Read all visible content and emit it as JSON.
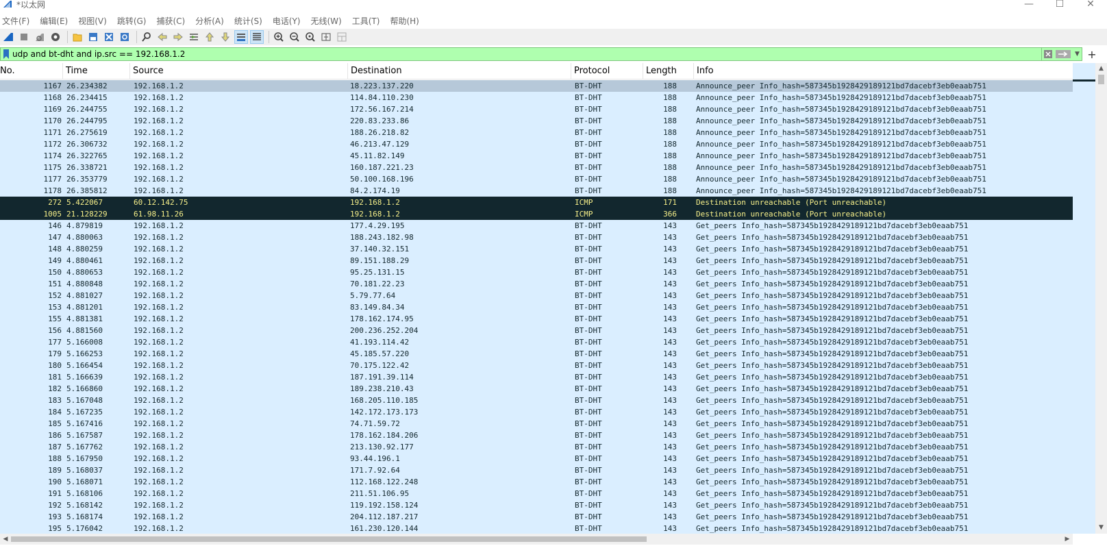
{
  "window": {
    "title": "*以太网"
  },
  "menu": [
    "文件(F)",
    "编辑(E)",
    "视图(V)",
    "跳转(G)",
    "捕获(C)",
    "分析(A)",
    "统计(S)",
    "电话(Y)",
    "无线(W)",
    "工具(T)",
    "帮助(H)"
  ],
  "filter": {
    "value": "udp and bt-dht and ip.src == 192.168.1.2"
  },
  "columns": {
    "no": "No.",
    "time": "Time",
    "source": "Source",
    "destination": "Destination",
    "protocol": "Protocol",
    "length": "Length",
    "info": "Info"
  },
  "colors": {
    "row_bg": "#daeeff",
    "selected_bg": "#b6c8d9",
    "icmp_bg": "#12272e",
    "icmp_fg": "#f7f08a",
    "filter_bg": "#afffaf"
  },
  "packets": [
    {
      "no": "1167",
      "time": "26.234382",
      "src": "192.168.1.2",
      "dst": "18.223.137.220",
      "proto": "BT-DHT",
      "len": "188",
      "info": "Announce_peer Info_hash=587345b1928429189121bd7dacebf3eb0eaab751",
      "style": "selected"
    },
    {
      "no": "1168",
      "time": "26.234415",
      "src": "192.168.1.2",
      "dst": "114.84.110.230",
      "proto": "BT-DHT",
      "len": "188",
      "info": "Announce_peer Info_hash=587345b1928429189121bd7dacebf3eb0eaab751",
      "style": "normal"
    },
    {
      "no": "1169",
      "time": "26.244755",
      "src": "192.168.1.2",
      "dst": "172.56.167.214",
      "proto": "BT-DHT",
      "len": "188",
      "info": "Announce_peer Info_hash=587345b1928429189121bd7dacebf3eb0eaab751",
      "style": "normal"
    },
    {
      "no": "1170",
      "time": "26.244795",
      "src": "192.168.1.2",
      "dst": "220.83.233.86",
      "proto": "BT-DHT",
      "len": "188",
      "info": "Announce_peer Info_hash=587345b1928429189121bd7dacebf3eb0eaab751",
      "style": "normal"
    },
    {
      "no": "1171",
      "time": "26.275619",
      "src": "192.168.1.2",
      "dst": "188.26.218.82",
      "proto": "BT-DHT",
      "len": "188",
      "info": "Announce_peer Info_hash=587345b1928429189121bd7dacebf3eb0eaab751",
      "style": "normal"
    },
    {
      "no": "1172",
      "time": "26.306732",
      "src": "192.168.1.2",
      "dst": "46.213.47.129",
      "proto": "BT-DHT",
      "len": "188",
      "info": "Announce_peer Info_hash=587345b1928429189121bd7dacebf3eb0eaab751",
      "style": "normal"
    },
    {
      "no": "1174",
      "time": "26.322765",
      "src": "192.168.1.2",
      "dst": "45.11.82.149",
      "proto": "BT-DHT",
      "len": "188",
      "info": "Announce_peer Info_hash=587345b1928429189121bd7dacebf3eb0eaab751",
      "style": "normal"
    },
    {
      "no": "1175",
      "time": "26.338721",
      "src": "192.168.1.2",
      "dst": "160.187.221.23",
      "proto": "BT-DHT",
      "len": "188",
      "info": "Announce_peer Info_hash=587345b1928429189121bd7dacebf3eb0eaab751",
      "style": "normal"
    },
    {
      "no": "1177",
      "time": "26.353779",
      "src": "192.168.1.2",
      "dst": "50.100.168.196",
      "proto": "BT-DHT",
      "len": "188",
      "info": "Announce_peer Info_hash=587345b1928429189121bd7dacebf3eb0eaab751",
      "style": "normal"
    },
    {
      "no": "1178",
      "time": "26.385812",
      "src": "192.168.1.2",
      "dst": "84.2.174.19",
      "proto": "BT-DHT",
      "len": "188",
      "info": "Announce_peer Info_hash=587345b1928429189121bd7dacebf3eb0eaab751",
      "style": "normal"
    },
    {
      "no": "272",
      "time": "5.422067",
      "src": "60.12.142.75",
      "dst": "192.168.1.2",
      "proto": "ICMP",
      "len": "171",
      "info": "Destination unreachable (Port unreachable)",
      "style": "dark"
    },
    {
      "no": "1005",
      "time": "21.128229",
      "src": "61.98.11.26",
      "dst": "192.168.1.2",
      "proto": "ICMP",
      "len": "366",
      "info": "Destination unreachable (Port unreachable)",
      "style": "dark"
    },
    {
      "no": "146",
      "time": "4.879819",
      "src": "192.168.1.2",
      "dst": "177.4.29.195",
      "proto": "BT-DHT",
      "len": "143",
      "info": "Get_peers Info_hash=587345b1928429189121bd7dacebf3eb0eaab751",
      "style": "normal"
    },
    {
      "no": "147",
      "time": "4.880063",
      "src": "192.168.1.2",
      "dst": "188.243.182.98",
      "proto": "BT-DHT",
      "len": "143",
      "info": "Get_peers Info_hash=587345b1928429189121bd7dacebf3eb0eaab751",
      "style": "normal"
    },
    {
      "no": "148",
      "time": "4.880259",
      "src": "192.168.1.2",
      "dst": "37.140.32.151",
      "proto": "BT-DHT",
      "len": "143",
      "info": "Get_peers Info_hash=587345b1928429189121bd7dacebf3eb0eaab751",
      "style": "normal"
    },
    {
      "no": "149",
      "time": "4.880461",
      "src": "192.168.1.2",
      "dst": "89.151.188.29",
      "proto": "BT-DHT",
      "len": "143",
      "info": "Get_peers Info_hash=587345b1928429189121bd7dacebf3eb0eaab751",
      "style": "normal"
    },
    {
      "no": "150",
      "time": "4.880653",
      "src": "192.168.1.2",
      "dst": "95.25.131.15",
      "proto": "BT-DHT",
      "len": "143",
      "info": "Get_peers Info_hash=587345b1928429189121bd7dacebf3eb0eaab751",
      "style": "normal"
    },
    {
      "no": "151",
      "time": "4.880848",
      "src": "192.168.1.2",
      "dst": "70.181.22.23",
      "proto": "BT-DHT",
      "len": "143",
      "info": "Get_peers Info_hash=587345b1928429189121bd7dacebf3eb0eaab751",
      "style": "normal"
    },
    {
      "no": "152",
      "time": "4.881027",
      "src": "192.168.1.2",
      "dst": "5.79.77.64",
      "proto": "BT-DHT",
      "len": "143",
      "info": "Get_peers Info_hash=587345b1928429189121bd7dacebf3eb0eaab751",
      "style": "normal"
    },
    {
      "no": "153",
      "time": "4.881201",
      "src": "192.168.1.2",
      "dst": "83.149.84.34",
      "proto": "BT-DHT",
      "len": "143",
      "info": "Get_peers Info_hash=587345b1928429189121bd7dacebf3eb0eaab751",
      "style": "normal"
    },
    {
      "no": "155",
      "time": "4.881381",
      "src": "192.168.1.2",
      "dst": "178.162.174.95",
      "proto": "BT-DHT",
      "len": "143",
      "info": "Get_peers Info_hash=587345b1928429189121bd7dacebf3eb0eaab751",
      "style": "normal"
    },
    {
      "no": "156",
      "time": "4.881560",
      "src": "192.168.1.2",
      "dst": "200.236.252.204",
      "proto": "BT-DHT",
      "len": "143",
      "info": "Get_peers Info_hash=587345b1928429189121bd7dacebf3eb0eaab751",
      "style": "normal"
    },
    {
      "no": "177",
      "time": "5.166008",
      "src": "192.168.1.2",
      "dst": "41.193.114.42",
      "proto": "BT-DHT",
      "len": "143",
      "info": "Get_peers Info_hash=587345b1928429189121bd7dacebf3eb0eaab751",
      "style": "normal"
    },
    {
      "no": "179",
      "time": "5.166253",
      "src": "192.168.1.2",
      "dst": "45.185.57.220",
      "proto": "BT-DHT",
      "len": "143",
      "info": "Get_peers Info_hash=587345b1928429189121bd7dacebf3eb0eaab751",
      "style": "normal"
    },
    {
      "no": "180",
      "time": "5.166454",
      "src": "192.168.1.2",
      "dst": "70.175.122.42",
      "proto": "BT-DHT",
      "len": "143",
      "info": "Get_peers Info_hash=587345b1928429189121bd7dacebf3eb0eaab751",
      "style": "normal"
    },
    {
      "no": "181",
      "time": "5.166639",
      "src": "192.168.1.2",
      "dst": "187.191.39.114",
      "proto": "BT-DHT",
      "len": "143",
      "info": "Get_peers Info_hash=587345b1928429189121bd7dacebf3eb0eaab751",
      "style": "normal"
    },
    {
      "no": "182",
      "time": "5.166860",
      "src": "192.168.1.2",
      "dst": "189.238.210.43",
      "proto": "BT-DHT",
      "len": "143",
      "info": "Get_peers Info_hash=587345b1928429189121bd7dacebf3eb0eaab751",
      "style": "normal"
    },
    {
      "no": "183",
      "time": "5.167048",
      "src": "192.168.1.2",
      "dst": "168.205.110.185",
      "proto": "BT-DHT",
      "len": "143",
      "info": "Get_peers Info_hash=587345b1928429189121bd7dacebf3eb0eaab751",
      "style": "normal"
    },
    {
      "no": "184",
      "time": "5.167235",
      "src": "192.168.1.2",
      "dst": "142.172.173.173",
      "proto": "BT-DHT",
      "len": "143",
      "info": "Get_peers Info_hash=587345b1928429189121bd7dacebf3eb0eaab751",
      "style": "normal"
    },
    {
      "no": "185",
      "time": "5.167416",
      "src": "192.168.1.2",
      "dst": "74.71.59.72",
      "proto": "BT-DHT",
      "len": "143",
      "info": "Get_peers Info_hash=587345b1928429189121bd7dacebf3eb0eaab751",
      "style": "normal"
    },
    {
      "no": "186",
      "time": "5.167587",
      "src": "192.168.1.2",
      "dst": "178.162.184.206",
      "proto": "BT-DHT",
      "len": "143",
      "info": "Get_peers Info_hash=587345b1928429189121bd7dacebf3eb0eaab751",
      "style": "normal"
    },
    {
      "no": "187",
      "time": "5.167762",
      "src": "192.168.1.2",
      "dst": "213.130.92.177",
      "proto": "BT-DHT",
      "len": "143",
      "info": "Get_peers Info_hash=587345b1928429189121bd7dacebf3eb0eaab751",
      "style": "normal"
    },
    {
      "no": "188",
      "time": "5.167950",
      "src": "192.168.1.2",
      "dst": "93.44.196.1",
      "proto": "BT-DHT",
      "len": "143",
      "info": "Get_peers Info_hash=587345b1928429189121bd7dacebf3eb0eaab751",
      "style": "normal"
    },
    {
      "no": "189",
      "time": "5.168037",
      "src": "192.168.1.2",
      "dst": "171.7.92.64",
      "proto": "BT-DHT",
      "len": "143",
      "info": "Get_peers Info_hash=587345b1928429189121bd7dacebf3eb0eaab751",
      "style": "normal"
    },
    {
      "no": "190",
      "time": "5.168071",
      "src": "192.168.1.2",
      "dst": "112.168.122.248",
      "proto": "BT-DHT",
      "len": "143",
      "info": "Get_peers Info_hash=587345b1928429189121bd7dacebf3eb0eaab751",
      "style": "normal"
    },
    {
      "no": "191",
      "time": "5.168106",
      "src": "192.168.1.2",
      "dst": "211.51.106.95",
      "proto": "BT-DHT",
      "len": "143",
      "info": "Get_peers Info_hash=587345b1928429189121bd7dacebf3eb0eaab751",
      "style": "normal"
    },
    {
      "no": "192",
      "time": "5.168142",
      "src": "192.168.1.2",
      "dst": "119.192.158.124",
      "proto": "BT-DHT",
      "len": "143",
      "info": "Get_peers Info_hash=587345b1928429189121bd7dacebf3eb0eaab751",
      "style": "normal"
    },
    {
      "no": "193",
      "time": "5.168174",
      "src": "192.168.1.2",
      "dst": "204.112.187.217",
      "proto": "BT-DHT",
      "len": "143",
      "info": "Get_peers Info_hash=587345b1928429189121bd7dacebf3eb0eaab751",
      "style": "normal"
    },
    {
      "no": "195",
      "time": "5.176042",
      "src": "192.168.1.2",
      "dst": "161.230.120.144",
      "proto": "BT-DHT",
      "len": "143",
      "info": "Get_peers Info_hash=587345b1928429189121bd7dacebf3eb0eaab751",
      "style": "normal"
    }
  ],
  "icons": {
    "toolbar": [
      "shark-fin-start-icon",
      "stop-icon",
      "restart-icon",
      "options-gear-icon",
      "open-folder-icon",
      "save-file-icon",
      "close-file-icon",
      "reload-icon",
      "find-icon",
      "back-arrow-icon",
      "forward-arrow-icon",
      "go-to-packet-icon",
      "first-packet-icon",
      "last-packet-icon",
      "autoscroll-icon",
      "colorize-icon",
      "zoom-in-icon",
      "zoom-out-icon",
      "zoom-normal-icon",
      "resize-columns-icon",
      "layout-grid-icon"
    ]
  }
}
